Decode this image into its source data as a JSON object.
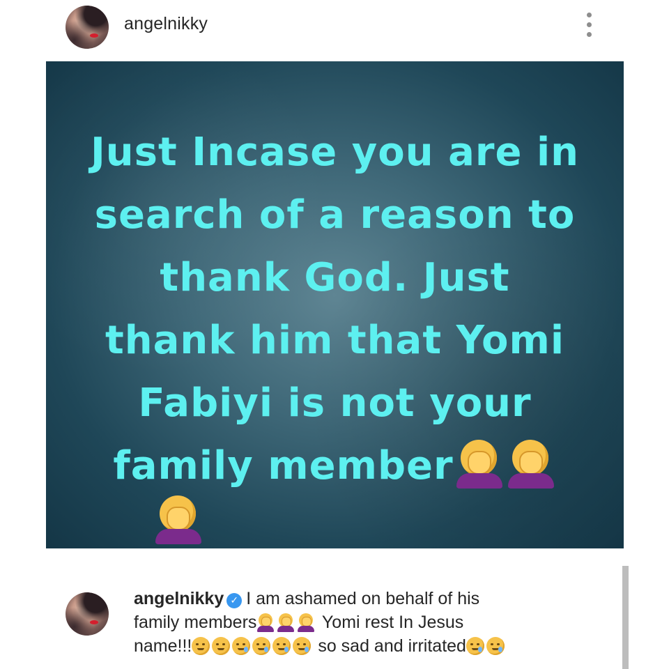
{
  "header": {
    "username": "angelnikky",
    "more_icon": "more-options-vertical-icon"
  },
  "post": {
    "image_text_lines": [
      "Just Incase you are in",
      "search of a reason to",
      "thank God. Just",
      "thank him that Yomi",
      "Fabiyi is not your",
      "family member"
    ],
    "emoji_count": 3,
    "emoji_icon": "face-palm-woman-icon",
    "text_color": "#5df0f0",
    "background_color": "#2a5568"
  },
  "comment": {
    "username": "angelnikky",
    "verified_icon": "verified-badge-icon",
    "text_part1": "I am ashamed on behalf of his",
    "text_part2": "family members",
    "text_part3": "Yomi rest In Jesus",
    "text_part4": "name!!!",
    "text_part5": "so sad and irritated"
  }
}
